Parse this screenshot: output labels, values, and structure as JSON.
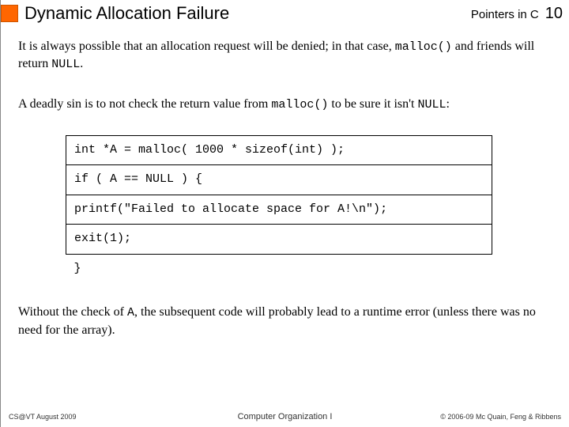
{
  "header": {
    "title": "Dynamic Allocation Failure",
    "section": "Pointers in C",
    "page": "10"
  },
  "body": {
    "p1_a": "It is always  possible that an allocation request will be denied; in that case, ",
    "p1_code": "malloc()",
    "p1_b": " and friends will return ",
    "p1_code2": "NULL",
    "p1_c": ".",
    "p2_a": "A deadly sin is to not check the return value from ",
    "p2_code": "malloc()",
    "p2_b": " to be sure it isn't ",
    "p2_code2": "NULL",
    "p2_c": ":",
    "code": {
      "l1": "int  *A = malloc( 1000 * sizeof(int) );",
      "l2": "if ( A == NULL ) {",
      "l3": "   printf(\"Failed to allocate space for A!\\n\");",
      "l4": "   exit(1);",
      "l5": "}"
    },
    "p3_a": "Without the check of ",
    "p3_code": "A",
    "p3_b": ", the subsequent code will probably lead to a runtime error (unless there was no need for the array)."
  },
  "footer": {
    "left": "CS@VT August 2009",
    "center": "Computer Organization I",
    "right": "© 2006-09  Mc Quain, Feng & Ribbens"
  }
}
